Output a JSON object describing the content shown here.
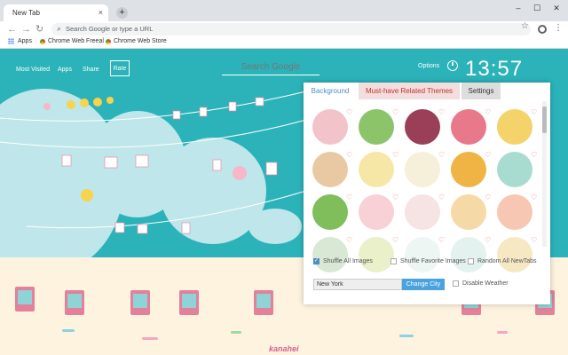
{
  "browser": {
    "tab_title": "New Tab",
    "tab_close": "×",
    "new_tab": "+",
    "minimize": "–",
    "maximize": "☐",
    "close": "✕",
    "omnibox_placeholder": "Search Google or type a URL",
    "bookmarks": [
      "Apps",
      "Chrome Web Freeal",
      "Chrome Web Store"
    ]
  },
  "topnav": {
    "links": [
      "Most Visited",
      "Apps",
      "Share"
    ],
    "rate": "Rate",
    "search_placeholder": "Search Google",
    "options": "Options",
    "time": "13:57"
  },
  "panel": {
    "tabs": [
      "Background",
      "Must-have Related Themes",
      "Settings"
    ],
    "thumbnails": [
      {
        "color": "#f2c3c9"
      },
      {
        "color": "#8cc46a"
      },
      {
        "color": "#9a3f57"
      },
      {
        "color": "#e8798b"
      },
      {
        "color": "#f4d36a"
      },
      {
        "color": "#e9c9a4"
      },
      {
        "color": "#f6e7a6"
      },
      {
        "color": "#f6efd9"
      },
      {
        "color": "#f0b445"
      },
      {
        "color": "#a9dcd1"
      },
      {
        "color": "#7fbe5a"
      },
      {
        "color": "#f7d1d6"
      },
      {
        "color": "#f6e3e3"
      },
      {
        "color": "#f5d9a6"
      },
      {
        "color": "#f7c7b3"
      },
      {
        "color": "#d9e8d4"
      },
      {
        "color": "#eaf0c9"
      },
      {
        "color": "#eef6f4"
      },
      {
        "color": "#e3f2ef"
      },
      {
        "color": "#f7e8c4"
      }
    ],
    "heart": "♡",
    "options": [
      {
        "label": "Shuffle All Images",
        "checked": true
      },
      {
        "label": "Shuffle Favorite Images",
        "checked": false
      },
      {
        "label": "Random All NewTabs",
        "checked": false
      }
    ],
    "city_value": "New York",
    "change_city": "Change City",
    "disable_weather": "Disable Weather"
  },
  "brand": "kanahei"
}
